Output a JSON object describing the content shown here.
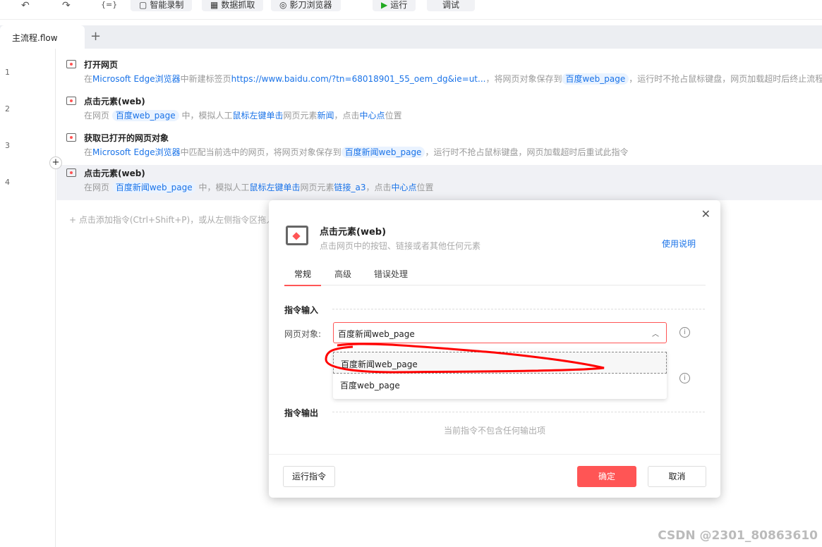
{
  "toolbar": {
    "undo_icon": "undo-icon",
    "redo_icon": "redo-icon",
    "vars_icon": "{=}",
    "record": "智能录制",
    "scrape": "数据抓取",
    "browser": "影刀浏览器",
    "run": "运行",
    "debug": "调试"
  },
  "tabs": {
    "active": "主流程.flow",
    "add": "+"
  },
  "rows": [
    {
      "num": "1",
      "title": "打开网页",
      "d": [
        "在",
        "Microsoft Edge浏览器",
        "中新建标签页",
        "https://www.baidu.com/?tn=68018901_55_oem_dg&ie=ut...",
        "，将网页对象保存到",
        "百度web_page",
        "，运行时不抢占鼠标键盘，网页加载超时后终止流程"
      ]
    },
    {
      "num": "2",
      "title": "点击元素(web)",
      "d": [
        "在网页",
        "百度web_page",
        "中，模拟人工",
        "鼠标左键单击",
        "网页元素",
        "新闻",
        "，点击",
        "中心点",
        "位置"
      ]
    },
    {
      "num": "3",
      "title": "获取已打开的网页对象",
      "d": [
        "在",
        "Microsoft Edge浏览器",
        "中匹配当前选中的网页，将网页对象保存到",
        "百度新闻web_page",
        "，运行时不抢占鼠标键盘，网页加载超时后重试此指令"
      ]
    },
    {
      "num": "4",
      "title": "点击元素(web)",
      "d": [
        "在网页",
        "百度新闻web_page",
        "中，模拟人工",
        "鼠标左键单击",
        "网页元素",
        "链接_a3",
        "，点击",
        "中心点",
        "位置"
      ]
    }
  ],
  "add_hint": "+  点击添加指令(Ctrl+Shift+P)，或从左侧指令区拖入",
  "dialog": {
    "title": "点击元素(web)",
    "subtitle": "点击网页中的按钮、链接或者其他任何元素",
    "help": "使用说明",
    "tabs": [
      "常规",
      "高级",
      "错误处理"
    ],
    "input_section": "指令输入",
    "field_label": "网页对象:",
    "field_value": "百度新闻web_page",
    "options": [
      "百度新闻web_page",
      "百度web_page"
    ],
    "output_section": "指令输出",
    "output_empty": "当前指令不包含任何输出项",
    "run_btn": "运行指令",
    "ok_btn": "确定",
    "cancel_btn": "取消"
  },
  "colors": {
    "accent": "#ff5555",
    "link": "#1a73e8"
  },
  "watermark": "CSDN @2301_80863610"
}
